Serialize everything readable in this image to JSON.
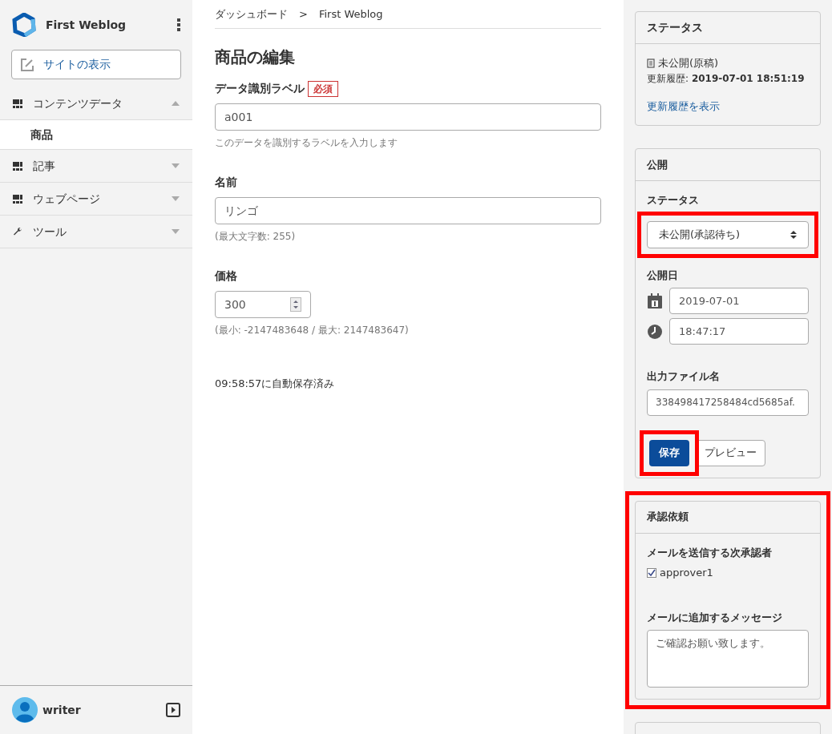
{
  "sidebar": {
    "site_name": "First Weblog",
    "view_site_button": "サイトの表示",
    "nav": [
      {
        "kind": "content",
        "label": "コンテンツデータ",
        "expanded": true,
        "children": [
          {
            "label": "商品",
            "selected": true
          }
        ]
      },
      {
        "kind": "content",
        "label": "記事",
        "expanded": false
      },
      {
        "kind": "content",
        "label": "ウェブページ",
        "expanded": false
      },
      {
        "kind": "tool",
        "label": "ツール",
        "expanded": false
      }
    ],
    "user": {
      "name": "writer"
    }
  },
  "breadcrumb": [
    "ダッシュボード",
    ">",
    "First Weblog"
  ],
  "main": {
    "title": "商品の編集",
    "fields": [
      {
        "kind": "text",
        "label": "データ識別ラベル",
        "required_badge": "必須",
        "value": "a001",
        "hint": "このデータを識別するラベルを入力します"
      },
      {
        "kind": "text",
        "label": "名前",
        "value": "リンゴ",
        "hint": "(最大文字数: 255)"
      },
      {
        "kind": "number",
        "label": "価格",
        "value": "300",
        "hint": "(最小: -2147483648 / 最大: 2147483647)"
      }
    ],
    "autosave": "09:58:57に自動保存済み"
  },
  "status_card": {
    "title": "ステータス",
    "state": "未公開(原稿)",
    "updated_label": "更新履歴:",
    "updated_value": "2019-07-01 18:51:19",
    "history_link": "更新履歴を表示"
  },
  "publish_card": {
    "title": "公開",
    "status_label": "ステータス",
    "status_value": "未公開(承認待ち)",
    "status_highlighted": true,
    "date_label": "公開日",
    "date": "2019-07-01",
    "time": "18:47:17",
    "filename_label": "出力ファイル名",
    "filename": "338498417258484cd5685af.",
    "save_button": "保存",
    "save_highlighted": true,
    "preview_button": "プレビュー"
  },
  "approval_card": {
    "title": "承認依頼",
    "highlighted": true,
    "approvers_label": "メールを送信する次承認者",
    "approvers": [
      {
        "name": "approver1",
        "checked": true
      }
    ],
    "message_label": "メールに追加するメッセージ",
    "message": "ご確認お願い致します。"
  }
}
